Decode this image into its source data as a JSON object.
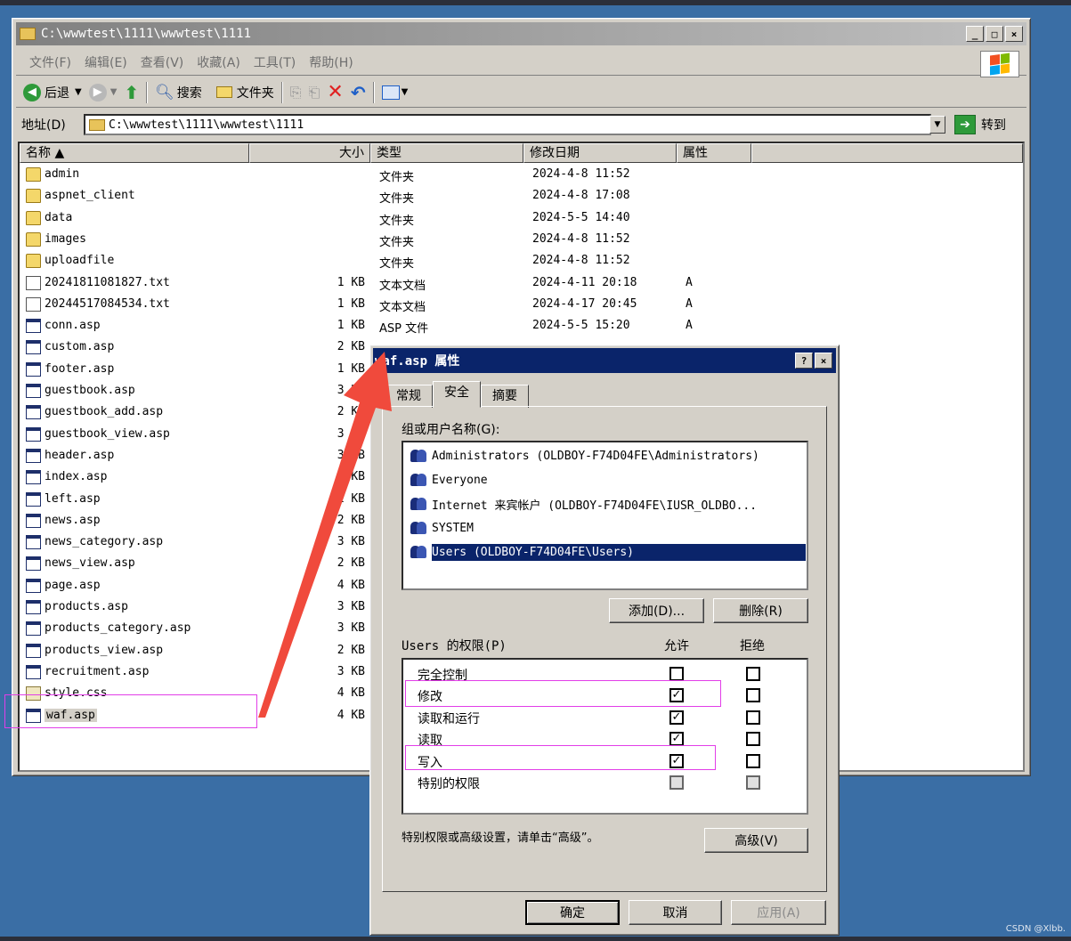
{
  "explorer": {
    "title": "C:\\wwwtest\\1111\\wwwtest\\1111",
    "menu": [
      "文件(F)",
      "编辑(E)",
      "查看(V)",
      "收藏(A)",
      "工具(T)",
      "帮助(H)"
    ],
    "toolbar": {
      "back": "后退",
      "search": "搜索",
      "folders": "文件夹"
    },
    "address_label": "地址(D)",
    "address_value": "C:\\wwwtest\\1111\\wwwtest\\1111",
    "goto_label": "转到",
    "columns": [
      "名称 ▲",
      "大小",
      "类型",
      "修改日期",
      "属性"
    ],
    "files": [
      {
        "name": "admin",
        "size": "",
        "type": "文件夹",
        "date": "2024-4-8 11:52",
        "attr": "",
        "icon": "folder"
      },
      {
        "name": "aspnet_client",
        "size": "",
        "type": "文件夹",
        "date": "2024-4-8 17:08",
        "attr": "",
        "icon": "folder"
      },
      {
        "name": "data",
        "size": "",
        "type": "文件夹",
        "date": "2024-5-5 14:40",
        "attr": "",
        "icon": "folder"
      },
      {
        "name": "images",
        "size": "",
        "type": "文件夹",
        "date": "2024-4-8 11:52",
        "attr": "",
        "icon": "folder"
      },
      {
        "name": "uploadfile",
        "size": "",
        "type": "文件夹",
        "date": "2024-4-8 11:52",
        "attr": "",
        "icon": "folder"
      },
      {
        "name": "20241811081827.txt",
        "size": "1 KB",
        "type": "文本文档",
        "date": "2024-4-11 20:18",
        "attr": "A",
        "icon": "txt"
      },
      {
        "name": "20244517084534.txt",
        "size": "1 KB",
        "type": "文本文档",
        "date": "2024-4-17 20:45",
        "attr": "A",
        "icon": "txt"
      },
      {
        "name": "conn.asp",
        "size": "1 KB",
        "type": "ASP 文件",
        "date": "2024-5-5 15:20",
        "attr": "A",
        "icon": "asp"
      },
      {
        "name": "custom.asp",
        "size": "2 KB",
        "type": "",
        "date": "",
        "attr": "",
        "icon": "asp"
      },
      {
        "name": "footer.asp",
        "size": "1 KB",
        "type": "",
        "date": "",
        "attr": "",
        "icon": "asp"
      },
      {
        "name": "guestbook.asp",
        "size": "3 KB",
        "type": "",
        "date": "",
        "attr": "",
        "icon": "asp"
      },
      {
        "name": "guestbook_add.asp",
        "size": "2 KB",
        "type": "",
        "date": "",
        "attr": "",
        "icon": "asp"
      },
      {
        "name": "guestbook_view.asp",
        "size": "3 KB",
        "type": "",
        "date": "",
        "attr": "",
        "icon": "asp"
      },
      {
        "name": "header.asp",
        "size": "3 KB",
        "type": "",
        "date": "",
        "attr": "",
        "icon": "asp"
      },
      {
        "name": "index.asp",
        "size": "4 KB",
        "type": "",
        "date": "",
        "attr": "",
        "icon": "asp"
      },
      {
        "name": "left.asp",
        "size": "1 KB",
        "type": "",
        "date": "",
        "attr": "",
        "icon": "asp"
      },
      {
        "name": "news.asp",
        "size": "2 KB",
        "type": "",
        "date": "",
        "attr": "",
        "icon": "asp"
      },
      {
        "name": "news_category.asp",
        "size": "3 KB",
        "type": "",
        "date": "",
        "attr": "",
        "icon": "asp"
      },
      {
        "name": "news_view.asp",
        "size": "2 KB",
        "type": "",
        "date": "",
        "attr": "",
        "icon": "asp"
      },
      {
        "name": "page.asp",
        "size": "4 KB",
        "type": "",
        "date": "",
        "attr": "",
        "icon": "asp"
      },
      {
        "name": "products.asp",
        "size": "3 KB",
        "type": "",
        "date": "",
        "attr": "",
        "icon": "asp"
      },
      {
        "name": "products_category.asp",
        "size": "3 KB",
        "type": "",
        "date": "",
        "attr": "",
        "icon": "asp"
      },
      {
        "name": "products_view.asp",
        "size": "2 KB",
        "type": "",
        "date": "",
        "attr": "",
        "icon": "asp"
      },
      {
        "name": "recruitment.asp",
        "size": "3 KB",
        "type": "",
        "date": "",
        "attr": "",
        "icon": "asp"
      },
      {
        "name": "style.css",
        "size": "4 KB",
        "type": "",
        "date": "",
        "attr": "",
        "icon": "css"
      },
      {
        "name": "waf.asp",
        "size": "4 KB",
        "type": "",
        "date": "",
        "attr": "",
        "icon": "asp"
      }
    ]
  },
  "dialog": {
    "title": "waf.asp 属性",
    "tabs": [
      "常规",
      "安全",
      "摘要"
    ],
    "active_tab": "安全",
    "users_label": "组或用户名称(G):",
    "users": [
      {
        "name": "Administrators (OLDBOY-F74D04FE\\Administrators)",
        "selected": false
      },
      {
        "name": "Everyone",
        "selected": false
      },
      {
        "name": "Internet 来宾帐户 (OLDBOY-F74D04FE\\IUSR_OLDBO...",
        "selected": false
      },
      {
        "name": "SYSTEM",
        "selected": false
      },
      {
        "name": "Users (OLDBOY-F74D04FE\\Users)",
        "selected": true
      }
    ],
    "add_button": "添加(D)...",
    "remove_button": "删除(R)",
    "perm_label": "Users 的权限(P)",
    "allow_label": "允许",
    "deny_label": "拒绝",
    "permissions": [
      {
        "name": "完全控制",
        "allow": false,
        "deny": false,
        "disabled": false
      },
      {
        "name": "修改",
        "allow": true,
        "deny": false,
        "disabled": false
      },
      {
        "name": "读取和运行",
        "allow": true,
        "deny": false,
        "disabled": false
      },
      {
        "name": "读取",
        "allow": true,
        "deny": false,
        "disabled": false
      },
      {
        "name": "写入",
        "allow": true,
        "deny": false,
        "disabled": false
      },
      {
        "name": "特别的权限",
        "allow": false,
        "deny": false,
        "disabled": true
      }
    ],
    "advanced_hint": "特别权限或高级设置，请单击“高级”。",
    "advanced_button": "高级(V)",
    "ok_button": "确定",
    "cancel_button": "取消",
    "apply_button": "应用(A)"
  },
  "watermark": "CSDN @Xlbb.",
  "colors": {
    "desktop": "#3a6ea5",
    "dialog_title": "#0a246a",
    "highlight_box": "#e23ee8",
    "arrow": "#f04a3c"
  }
}
